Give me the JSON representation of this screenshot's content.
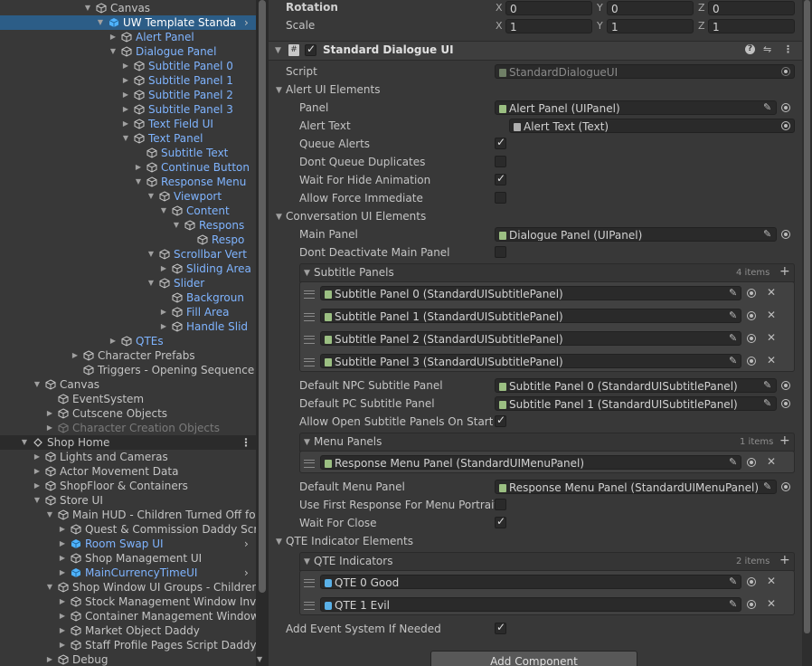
{
  "hierarchy": {
    "rows": [
      {
        "label": "Canvas",
        "indent": 106,
        "arrow": "▼",
        "style": ""
      },
      {
        "label": "UW Template Standa",
        "indent": 120,
        "arrow": "▼",
        "style": "sel",
        "chev": true,
        "cubeBlue": true
      },
      {
        "label": "Alert Panel",
        "indent": 134,
        "arrow": "▶",
        "style": "blue"
      },
      {
        "label": "Dialogue Panel",
        "indent": 134,
        "arrow": "▼",
        "style": "blue"
      },
      {
        "label": "Subtitle Panel 0",
        "indent": 148,
        "arrow": "▶",
        "style": "blue"
      },
      {
        "label": "Subtitle Panel 1",
        "indent": 148,
        "arrow": "▶",
        "style": "blue"
      },
      {
        "label": "Subtitle Panel 2",
        "indent": 148,
        "arrow": "▶",
        "style": "blue"
      },
      {
        "label": "Subtitle Panel 3",
        "indent": 148,
        "arrow": "▶",
        "style": "blue"
      },
      {
        "label": "Text Field UI",
        "indent": 148,
        "arrow": "▶",
        "style": "blue"
      },
      {
        "label": "Text Panel",
        "indent": 148,
        "arrow": "▼",
        "style": "blue"
      },
      {
        "label": "Subtitle Text",
        "indent": 162,
        "arrow": "",
        "style": "blue"
      },
      {
        "label": "Continue Button",
        "indent": 162,
        "arrow": "▶",
        "style": "blue"
      },
      {
        "label": "Response Menu",
        "indent": 162,
        "arrow": "▼",
        "style": "blue"
      },
      {
        "label": "Viewport",
        "indent": 176,
        "arrow": "▼",
        "style": "blue"
      },
      {
        "label": "Content",
        "indent": 190,
        "arrow": "▼",
        "style": "blue"
      },
      {
        "label": "Respons",
        "indent": 204,
        "arrow": "▼",
        "style": "blue"
      },
      {
        "label": "Respo",
        "indent": 218,
        "arrow": "",
        "style": "blue"
      },
      {
        "label": "Scrollbar Vert",
        "indent": 176,
        "arrow": "▼",
        "style": "blue"
      },
      {
        "label": "Sliding Area",
        "indent": 190,
        "arrow": "▶",
        "style": "blue"
      },
      {
        "label": "Slider",
        "indent": 176,
        "arrow": "▼",
        "style": "blue"
      },
      {
        "label": "Backgroun",
        "indent": 190,
        "arrow": "",
        "style": "blue"
      },
      {
        "label": "Fill Area",
        "indent": 190,
        "arrow": "▶",
        "style": "blue"
      },
      {
        "label": "Handle Slid",
        "indent": 190,
        "arrow": "▶",
        "style": "blue"
      },
      {
        "label": "QTEs",
        "indent": 134,
        "arrow": "▶",
        "style": "blue"
      },
      {
        "label": "Character Prefabs",
        "indent": 92,
        "arrow": "▶",
        "style": ""
      },
      {
        "label": "Triggers - Opening Sequence",
        "indent": 92,
        "arrow": "",
        "style": ""
      },
      {
        "label": "Canvas",
        "indent": 50,
        "arrow": "▼",
        "style": ""
      },
      {
        "label": "EventSystem",
        "indent": 64,
        "arrow": "",
        "style": ""
      },
      {
        "label": "Cutscene Objects",
        "indent": 64,
        "arrow": "▶",
        "style": ""
      },
      {
        "label": "Character Creation Objects",
        "indent": 64,
        "arrow": "▶",
        "style": "dim"
      },
      {
        "label": "Shop Home",
        "indent": 36,
        "arrow": "▼",
        "style": "scene",
        "menu": true
      },
      {
        "label": "Lights and Cameras",
        "indent": 50,
        "arrow": "▶",
        "style": ""
      },
      {
        "label": "Actor Movement Data",
        "indent": 50,
        "arrow": "▶",
        "style": ""
      },
      {
        "label": "ShopFloor & Containers",
        "indent": 50,
        "arrow": "▶",
        "style": ""
      },
      {
        "label": "Store UI",
        "indent": 50,
        "arrow": "▼",
        "style": ""
      },
      {
        "label": "Main HUD - Children Turned Off fo",
        "indent": 64,
        "arrow": "▼",
        "style": ""
      },
      {
        "label": "Quest & Commission Daddy Scr",
        "indent": 78,
        "arrow": "▶",
        "style": ""
      },
      {
        "label": "Room Swap UI",
        "indent": 78,
        "arrow": "▶",
        "style": "blue",
        "chev": true,
        "cubeBlue": true
      },
      {
        "label": "Shop Management UI",
        "indent": 78,
        "arrow": "▶",
        "style": ""
      },
      {
        "label": "MainCurrencyTimeUI",
        "indent": 78,
        "arrow": "▶",
        "style": "blue",
        "chev": true,
        "cubeBlue": true
      },
      {
        "label": "Shop Window UI Groups - Children",
        "indent": 64,
        "arrow": "▼",
        "style": ""
      },
      {
        "label": "Stock Management Window Inv",
        "indent": 78,
        "arrow": "▶",
        "style": ""
      },
      {
        "label": "Container Management Window",
        "indent": 78,
        "arrow": "▶",
        "style": ""
      },
      {
        "label": "Market Object Daddy",
        "indent": 78,
        "arrow": "▶",
        "style": ""
      },
      {
        "label": "Staff Profile Pages Script Daddy",
        "indent": 78,
        "arrow": "▶",
        "style": ""
      },
      {
        "label": "Debug",
        "indent": 64,
        "arrow": "▶",
        "style": ""
      }
    ]
  },
  "transform": {
    "rotation": {
      "label": "Rotation",
      "x": "0",
      "y": "0",
      "z": "0"
    },
    "scale": {
      "label": "Scale",
      "x": "1",
      "y": "1",
      "z": "1"
    },
    "axis_x": "X",
    "axis_y": "Y",
    "axis_z": "Z"
  },
  "component": {
    "title": "Standard Dialogue UI",
    "enabled": true,
    "script_label": "Script",
    "script_value": "StandardDialogueUI",
    "add_component": "Add Component"
  },
  "alert": {
    "section": "Alert UI Elements",
    "panel_label": "Panel",
    "panel_value": "Alert Panel (UIPanel)",
    "text_label": "Alert Text",
    "text_value": "Alert Text (Text)",
    "queue_label": "Queue Alerts",
    "queue": true,
    "dont_queue_label": "Dont Queue Duplicates",
    "dont_queue": false,
    "wait_hide_label": "Wait For Hide Animation",
    "wait_hide": true,
    "force_label": "Allow Force Immediate",
    "force": false
  },
  "conversation": {
    "section": "Conversation UI Elements",
    "main_label": "Main Panel",
    "main_value": "Dialogue Panel (UIPanel)",
    "dont_deact_label": "Dont Deactivate Main Panel",
    "dont_deact": false,
    "subtitle_panels": {
      "label": "Subtitle Panels",
      "count": "4 items",
      "items": [
        "Subtitle Panel 0 (StandardUISubtitlePanel)",
        "Subtitle Panel 1 (StandardUISubtitlePanel)",
        "Subtitle Panel 2 (StandardUISubtitlePanel)",
        "Subtitle Panel 3 (StandardUISubtitlePanel)"
      ]
    },
    "npc_label": "Default NPC Subtitle Panel",
    "npc_value": "Subtitle Panel 0 (StandardUISubtitlePanel)",
    "pc_label": "Default PC Subtitle Panel",
    "pc_value": "Subtitle Panel 1 (StandardUISubtitlePanel)",
    "allow_open_label": "Allow Open Subtitle Panels On Start Co",
    "allow_open": true,
    "menu_panels": {
      "label": "Menu Panels",
      "count": "1 items",
      "items": [
        "Response Menu Panel (StandardUIMenuPanel)"
      ]
    },
    "default_menu_label": "Default Menu Panel",
    "default_menu_value": "Response Menu Panel (StandardUIMenuPanel)",
    "use_first_label": "Use First Response For Menu Portrait",
    "use_first": false,
    "wait_close_label": "Wait For Close",
    "wait_close": true
  },
  "qte": {
    "section": "QTE Indicator Elements",
    "indicators": {
      "label": "QTE Indicators",
      "count": "2 items",
      "items": [
        "QTE 0 Good",
        "QTE 1 Evil"
      ]
    },
    "add_event_label": "Add Event System If Needed",
    "add_event": true
  }
}
